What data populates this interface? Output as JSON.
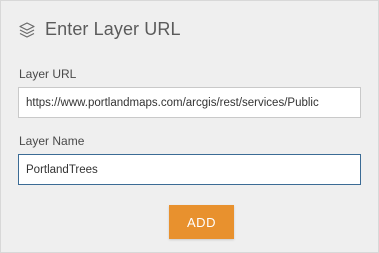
{
  "dialog": {
    "title": "Enter Layer URL",
    "title_icon": "layers-icon"
  },
  "form": {
    "layer_url": {
      "label": "Layer URL",
      "value": "https://www.portlandmaps.com/arcgis/rest/services/Public"
    },
    "layer_name": {
      "label": "Layer Name",
      "value": "PortlandTrees"
    },
    "add_label": "ADD"
  },
  "colors": {
    "accent": "#e8912e",
    "focus_border": "#3b6b95"
  }
}
